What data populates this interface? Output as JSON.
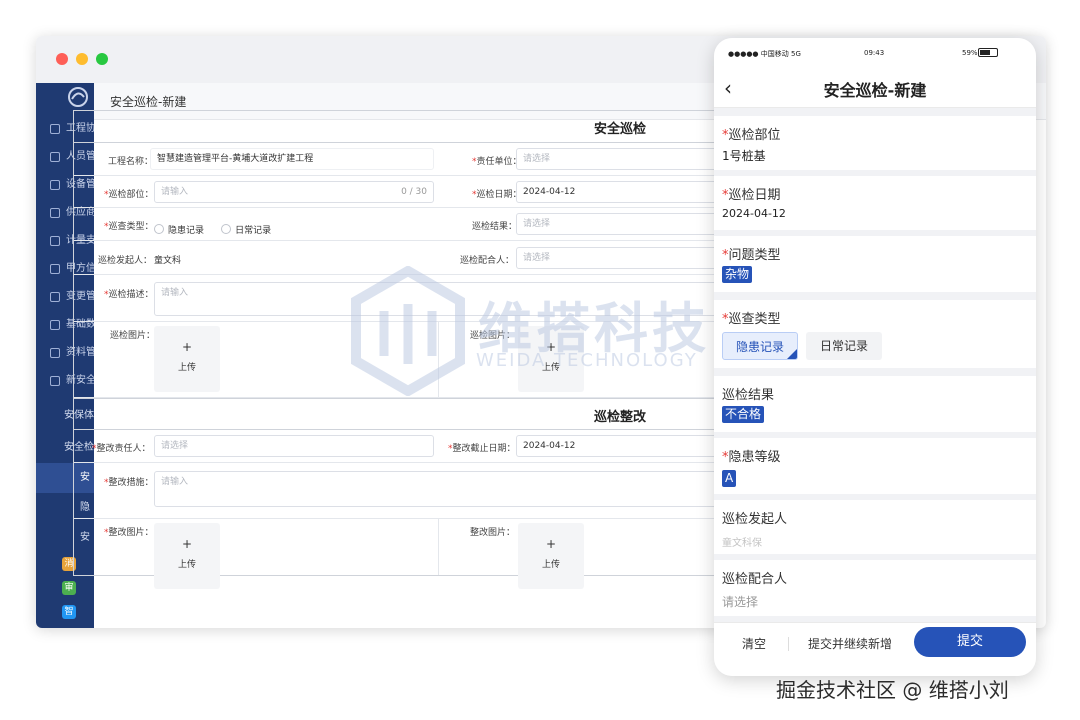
{
  "desktop": {
    "page_title": "安全巡检-新建",
    "sidebar": {
      "items": [
        "工程协",
        "人员管",
        "设备管",
        "供应商",
        "计量支",
        "甲方信",
        "变更管",
        "基础数",
        "资料管",
        "新安全"
      ],
      "sub_items": [
        "安保体",
        "安全检",
        "安",
        "隐",
        "安"
      ],
      "apps": [
        "消",
        "审",
        "智"
      ]
    },
    "section1_title": "安全巡检",
    "section2_title": "巡检整改",
    "fields": {
      "project_name_label": "工程名称：",
      "project_name_value": "智慧建造管理平台-黄埔大道改扩建工程",
      "responsible_unit_label": "责任单位：",
      "responsible_unit_placeholder": "请选择",
      "location_label": "巡检部位：",
      "location_placeholder": "请输入",
      "location_counter": "0 / 30",
      "date_label": "巡检日期：",
      "date_value": "2024-04-12",
      "type_label": "巡查类型：",
      "type_option1": "隐患记录",
      "type_option2": "日常记录",
      "result_label": "巡检结果：",
      "result_placeholder": "请选择",
      "initiator_label": "巡检发起人：",
      "initiator_value": "童文科",
      "partner_label": "巡检配合人：",
      "partner_placeholder": "请选择",
      "desc_label": "巡检描述：",
      "desc_placeholder": "请输入",
      "photo_label_left": "巡检图片：",
      "photo_label_right": "巡检图片：",
      "upload_plus": "+",
      "upload_label": "上传",
      "rect_person_label": "整改责任人：",
      "rect_person_placeholder": "请选择",
      "rect_deadline_label": "整改截止日期：",
      "rect_deadline_value": "2024-04-12",
      "rect_measure_label": "整改措施：",
      "rect_measure_placeholder": "请输入",
      "rect_photo_label_left": "整改图片：",
      "rect_photo_label_right": "整改图片："
    }
  },
  "watermark": {
    "cn": "维搭科技",
    "en": "WEIDA TECHNOLOGY"
  },
  "mobile": {
    "status": {
      "carrier": "●●●●● 中国移动  5G",
      "time": "09:43",
      "battery": "59%"
    },
    "title": "安全巡检-新建",
    "back_glyph": "‹",
    "fields": {
      "location_label": "巡检部位",
      "location_value": "1号桩基",
      "date_label": "巡检日期",
      "date_value": "2024-04-12",
      "issue_type_label": "问题类型",
      "issue_type_value": "杂物",
      "check_type_label": "巡查类型",
      "check_type_selected": "隐患记录",
      "check_type_other": "日常记录",
      "result_label": "巡检结果",
      "result_value": "不合格",
      "level_label": "隐患等级",
      "level_value": "A",
      "initiator_label": "巡检发起人",
      "initiator_value": "童文科保",
      "partner_label": "巡检配合人",
      "partner_placeholder": "请选择"
    },
    "bottom": {
      "clear": "清空",
      "submit_continue": "提交并继续新增",
      "submit": "提交"
    }
  },
  "credit": "掘金技术社区 @ 维搭小刘",
  "colors": {
    "sidebar": "#1f3a72",
    "accent": "#2653b8",
    "required": "#e53935"
  }
}
